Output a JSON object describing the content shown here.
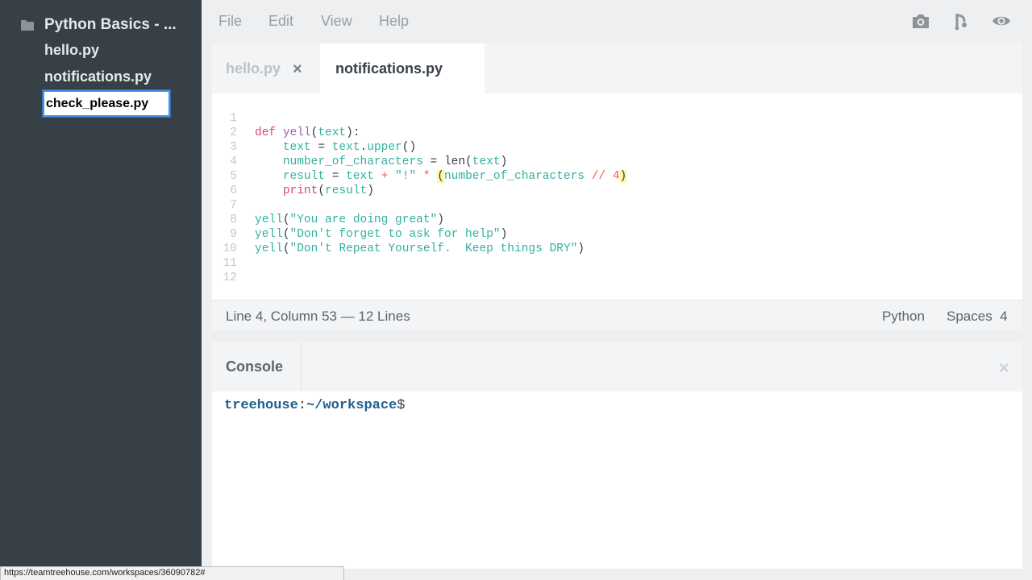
{
  "sidebar": {
    "project_name": "Python Basics - ...",
    "files": [
      "hello.py",
      "notifications.py"
    ],
    "rename_value": "check_please.py"
  },
  "menubar": {
    "items": [
      "File",
      "Edit",
      "View",
      "Help"
    ],
    "icons": [
      "camera-icon",
      "share-fork-icon",
      "eye-icon"
    ]
  },
  "editor": {
    "tabs": [
      {
        "label": "hello.py",
        "active": false,
        "close": "×"
      },
      {
        "label": "notifications.py",
        "active": true
      }
    ],
    "line_numbers": [
      "1",
      "2",
      "3",
      "4",
      "5",
      "6",
      "7",
      "8",
      "9",
      "10",
      "11",
      "12"
    ],
    "code": [
      "def yell(text):",
      "    text = text.upper()",
      "    number_of_characters = len(text)",
      "    result = text + \"!\" * (number_of_characters // 4)",
      "    print(result)",
      "",
      "yell(\"You are doing great\")",
      "yell(\"Don't forget to ask for help\")",
      "yell(\"Don't Repeat Yourself.  Keep things DRY\")",
      "",
      "",
      ""
    ],
    "status": {
      "position": "Line 4, Column 53 — 12 Lines",
      "language": "Python",
      "indent": "Spaces  4"
    }
  },
  "console": {
    "title": "Console",
    "close": "×",
    "prompt_user": "treehouse",
    "prompt_colon": ":",
    "prompt_path": "~/workspace",
    "prompt_dollar": "$"
  },
  "browser": {
    "status_url": "https://teamtreehouse.com/workspaces/36090782#"
  }
}
